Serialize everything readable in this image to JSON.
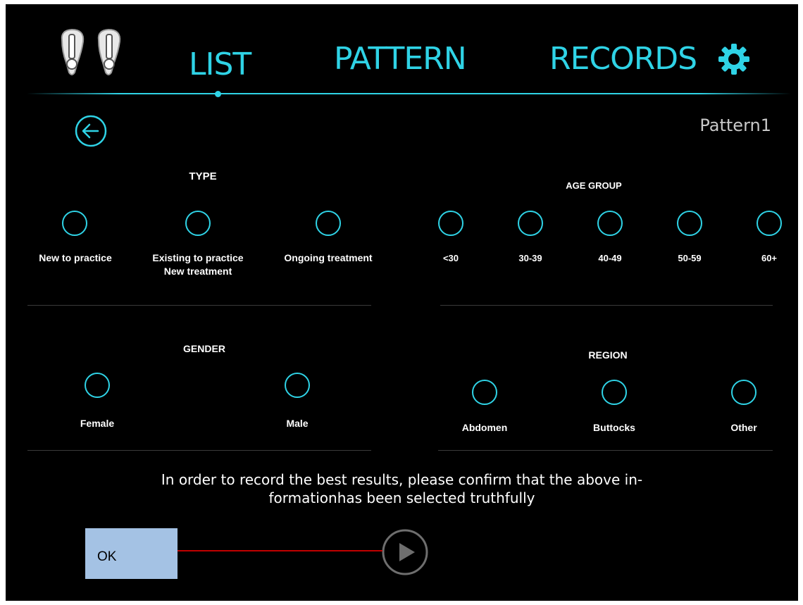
{
  "header": {
    "tabs": [
      {
        "label": "LIST"
      },
      {
        "label": "PATTERN"
      },
      {
        "label": "RECORDS"
      }
    ],
    "active_tab": "LIST",
    "logo_icon": "probe-pair-icon",
    "settings_icon": "gear-icon"
  },
  "subheader": {
    "back_icon": "back-arrow-icon",
    "pattern_name": "Pattern1"
  },
  "sections": {
    "type": {
      "title": "TYPE",
      "options": [
        "New to practice",
        "Existing to practice\nNew treatment",
        "Ongoing treatment"
      ]
    },
    "age_group": {
      "title": "AGE GROUP",
      "options": [
        "<30",
        "30-39",
        "40-49",
        "50-59",
        "60+"
      ]
    },
    "gender": {
      "title": "GENDER",
      "options": [
        "Female",
        "Male"
      ]
    },
    "region": {
      "title": "REGION",
      "options": [
        "Abdomen",
        "Buttocks",
        "Other"
      ]
    }
  },
  "notice": {
    "line1": "In order to record the best results, please confirm that the above in-",
    "line2": "formationhas been selected truthfully"
  },
  "play_icon": "play-icon",
  "annotation": {
    "label": "OK"
  },
  "colors": {
    "accent": "#2fd3e6",
    "background": "#000000",
    "annotation_box": "#a4c2e4",
    "annotation_line": "#c00000"
  }
}
